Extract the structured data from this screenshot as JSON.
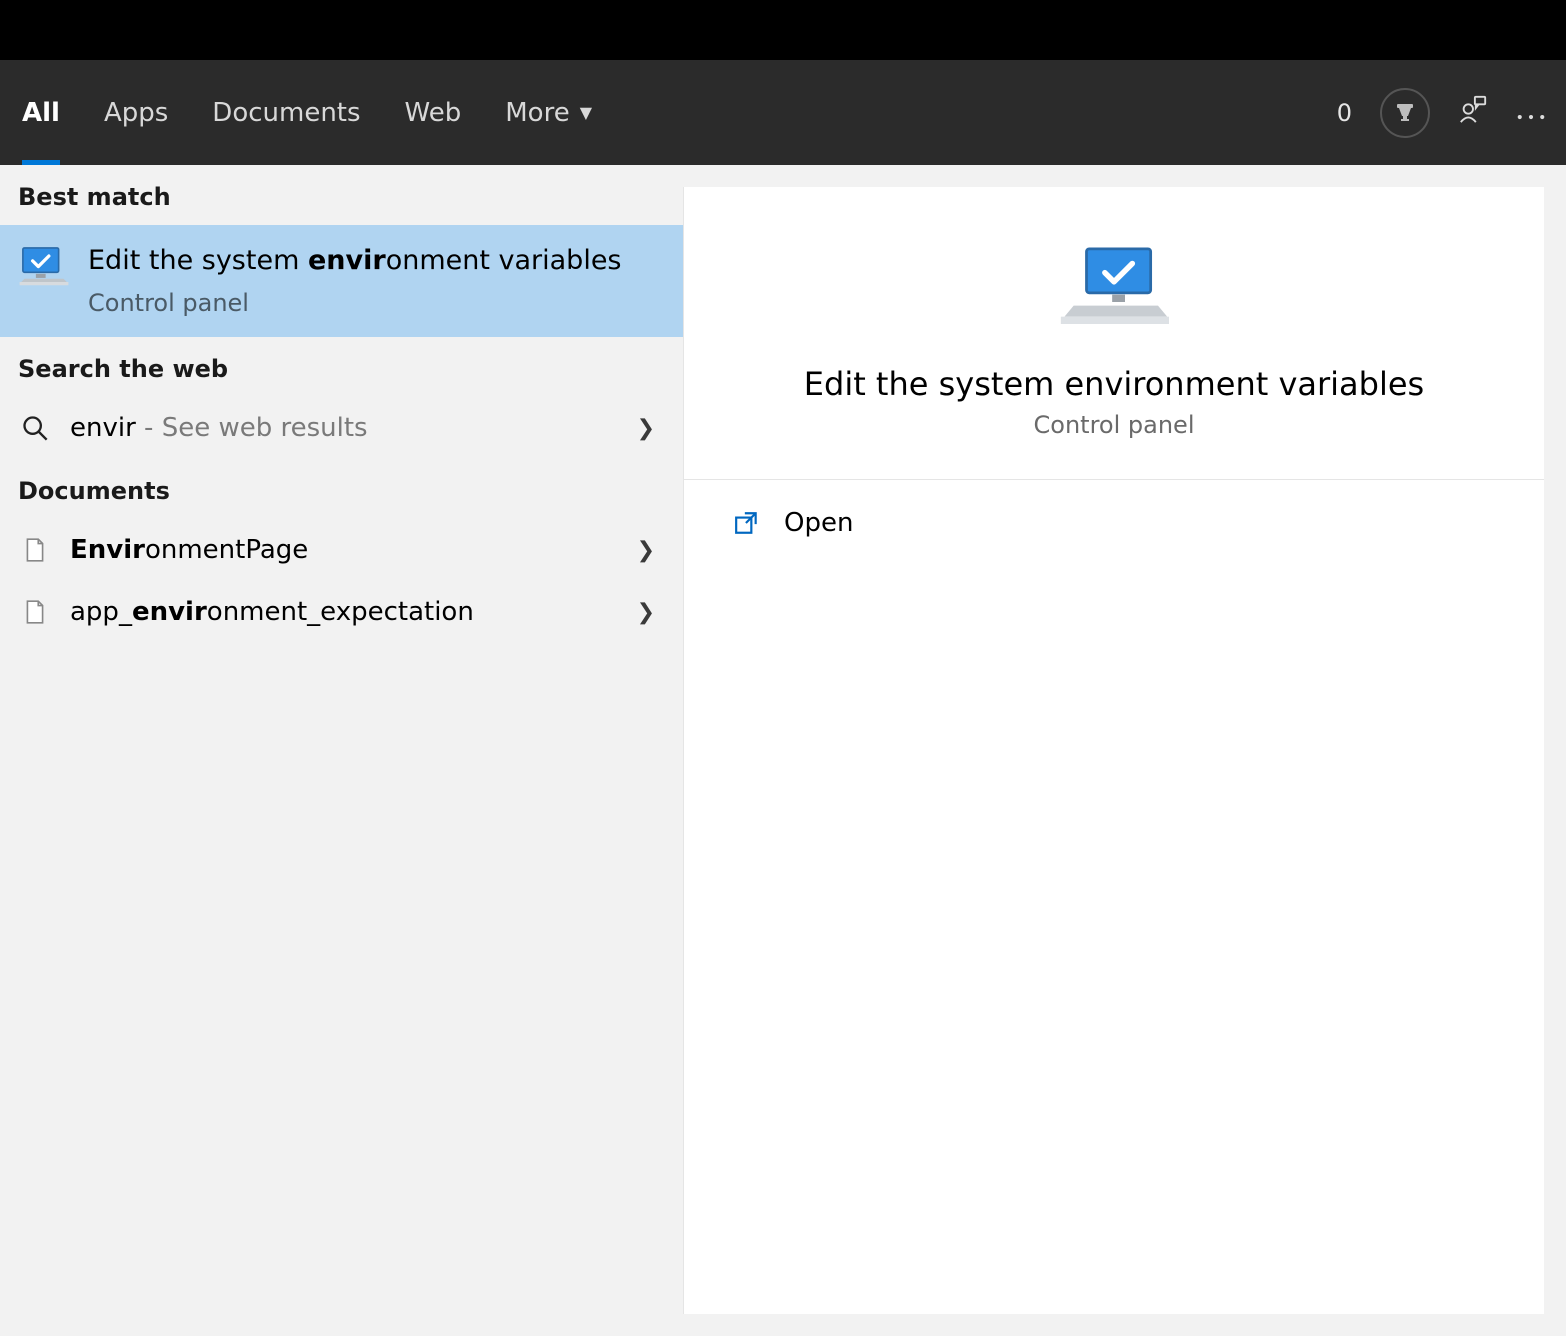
{
  "header": {
    "tabs": {
      "all": "All",
      "apps": "Apps",
      "docs": "Documents",
      "web": "Web",
      "more": "More"
    },
    "score": "0"
  },
  "left": {
    "best_match_label": "Best match",
    "best_match": {
      "title_pre": "Edit the system ",
      "title_bold": "envir",
      "title_post": "onment variables",
      "subtitle": "Control panel"
    },
    "web_label": "Search the web",
    "web_item": {
      "query": "envir",
      "suffix": " - See web results"
    },
    "docs_label": "Documents",
    "docs": [
      {
        "pre": "",
        "bold": "Envir",
        "post": "onmentPage"
      },
      {
        "pre": "app_",
        "bold": "envir",
        "post": "onment_expectation"
      }
    ]
  },
  "detail": {
    "title": "Edit the system environment variables",
    "subtitle": "Control panel",
    "open_label": "Open"
  }
}
